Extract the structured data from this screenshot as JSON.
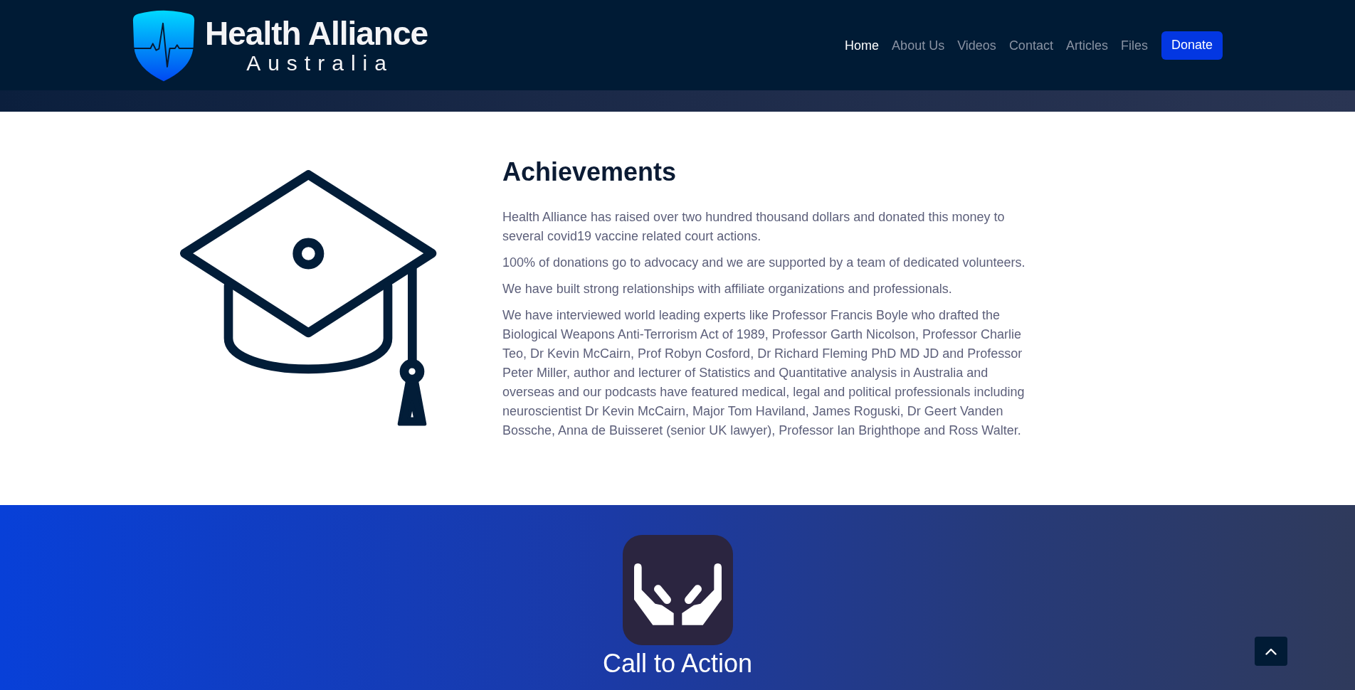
{
  "header": {
    "logo": {
      "name": "Health Alliance",
      "tagline": "Australia"
    },
    "nav": [
      {
        "label": "Home",
        "selected": true
      },
      {
        "label": "About Us",
        "selected": false
      },
      {
        "label": "Videos",
        "selected": false
      },
      {
        "label": "Contact",
        "selected": false
      },
      {
        "label": "Articles",
        "selected": false
      },
      {
        "label": "Files",
        "selected": false
      }
    ],
    "donate_button": {
      "label": "Donate"
    }
  },
  "achievements": {
    "title": "Achievements",
    "paragraphs": [
      "Health Alliance has raised over two hundred thousand dollars and donated this money to several covid19 vaccine related court actions.",
      "100% of donations go to advocacy and we are supported by a team of dedicated volunteers.",
      "We have built strong relationships with affiliate organizations and professionals.",
      "We have interviewed world leading experts like Professor Francis Boyle who drafted the Biological Weapons Anti-Terrorism Act of 1989, Professor Garth Nicolson, Professor Charlie Teo, Dr Kevin McCairn, Prof Robyn Cosford, Dr Richard Fleming PhD MD JD and Professor Peter Miller, author and lecturer of Statistics and Quantitative analysis in Australia and overseas and our podcasts have featured medical, legal and political professionals including neuroscientist Dr Kevin McCairn, Major Tom Haviland, James Roguski, Dr Geert Vanden Bossche, Anna de Buisseret (senior UK lawyer), Professor Ian Brighthope and Ross Walter."
    ]
  },
  "call_to_action": {
    "title": "Call to Action"
  }
}
